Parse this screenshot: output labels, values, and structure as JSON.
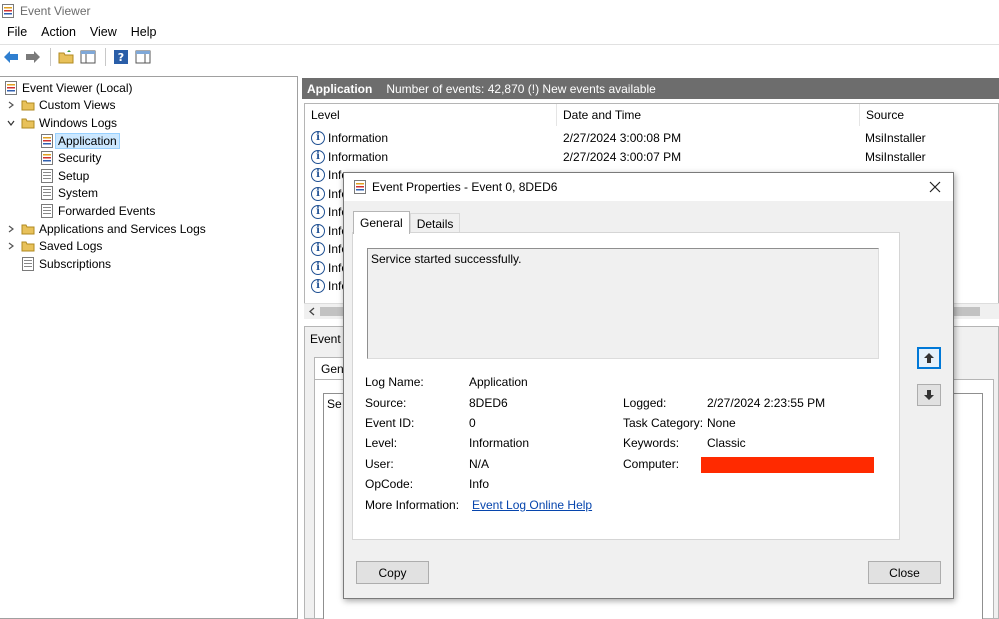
{
  "window": {
    "title": "Event Viewer",
    "icon": "event-viewer-icon"
  },
  "menu": [
    "File",
    "Action",
    "View",
    "Help"
  ],
  "toolbar": {
    "buttons": [
      "back-arrow-icon",
      "forward-arrow-icon",
      "open-folder-icon",
      "show-hide-console-tree-icon",
      "help-icon",
      "action-pane-icon"
    ]
  },
  "tree": {
    "root": "Event Viewer (Local)",
    "custom_views": "Custom Views",
    "windows_logs": "Windows Logs",
    "application": "Application",
    "security": "Security",
    "setup": "Setup",
    "system": "System",
    "forwarded_events": "Forwarded Events",
    "apps_services_logs": "Applications and Services Logs",
    "saved_logs": "Saved Logs",
    "subscriptions": "Subscriptions"
  },
  "log_header": {
    "title": "Application",
    "info": "Number of events: 42,870 (!) New events available"
  },
  "columns": {
    "level": "Level",
    "date_time": "Date and Time",
    "source": "Source"
  },
  "events": [
    {
      "level": "Information",
      "date": "2/27/2024 3:00:08 PM",
      "source": "MsiInstaller"
    },
    {
      "level": "Information",
      "date": "2/27/2024 3:00:07 PM",
      "source": "MsiInstaller"
    },
    {
      "level": "Info",
      "date": "",
      "source": ""
    },
    {
      "level": "Info",
      "date": "",
      "source": ""
    },
    {
      "level": "Info",
      "date": "",
      "source": ""
    },
    {
      "level": "Info",
      "date": "",
      "source": ""
    },
    {
      "level": "Info",
      "date": "",
      "source": ""
    },
    {
      "level": "Info",
      "date": "",
      "source": ""
    },
    {
      "level": "Info",
      "date": "",
      "source": ""
    }
  ],
  "detail_pane": {
    "title": "Event",
    "tab": "Gene",
    "text": "Se"
  },
  "dialog": {
    "title": "Event Properties - Event 0, 8DED6",
    "tabs": [
      "General",
      "Details"
    ],
    "description": "Service started successfully.",
    "labels": {
      "log_name": "Log Name:",
      "source": "Source:",
      "event_id": "Event ID:",
      "level": "Level:",
      "user": "User:",
      "opcode": "OpCode:",
      "more_info": "More Information:",
      "logged": "Logged:",
      "task_category": "Task Category:",
      "keywords": "Keywords:",
      "computer": "Computer:"
    },
    "values": {
      "log_name": "Application",
      "source": "8DED6",
      "event_id": "0",
      "level": "Information",
      "user": "N/A",
      "opcode": "Info",
      "more_info": "Event Log Online Help",
      "logged": "2/27/2024 2:23:55 PM",
      "task_category": "None",
      "keywords": "Classic"
    },
    "copy_label": "Copy",
    "close_label": "Close"
  },
  "colors": {
    "header_bg": "#6d6d6d",
    "selection": "#cce8ff",
    "redaction": "#ff2a00",
    "link": "#0645ad"
  }
}
